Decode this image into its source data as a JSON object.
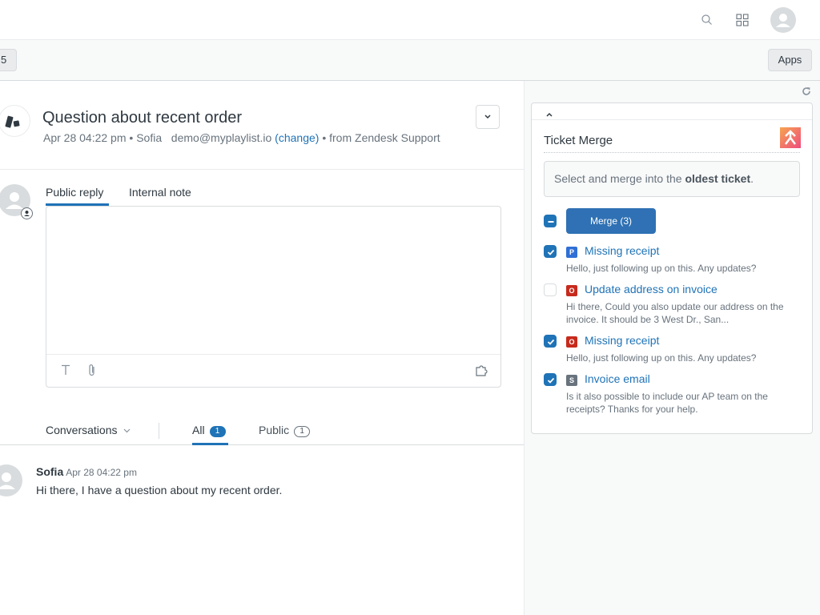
{
  "topbar": {
    "search_icon": "search-icon",
    "apps_grid_icon": "grid-icon",
    "avatar_icon": "user-avatar"
  },
  "subbar": {
    "tab_count": "5",
    "apps_button": "Apps"
  },
  "ticket": {
    "title": "Question about recent order",
    "date": "Apr 28 04:22 pm",
    "requester": "Sofia",
    "email": "demo@myplaylist.io",
    "change_link": "(change)",
    "source": "from Zendesk Support",
    "separator": "•"
  },
  "reply": {
    "tabs": [
      {
        "label": "Public reply",
        "active": true
      },
      {
        "label": "Internal note",
        "active": false
      }
    ],
    "text": "",
    "toolbar": [
      "text-format-icon",
      "attachment-icon",
      "apps-puzzle-icon"
    ]
  },
  "conversations": {
    "select_label": "Conversations",
    "filters": [
      {
        "label": "All",
        "count": "1",
        "active": true
      },
      {
        "label": "Public",
        "count": "1",
        "active": false
      }
    ]
  },
  "comments": [
    {
      "author": "Sofia",
      "time": "Apr 28 04:22 pm",
      "body": "Hi there, I have a question about my recent order."
    }
  ],
  "app": {
    "name": "Ticket Merge",
    "info_prefix": "Select and merge into the ",
    "info_bold": "oldest ticket",
    "info_suffix": ".",
    "merge_button": "Merge (3)",
    "select_all_state": "indeterminate",
    "brand_color": "#1f73b7",
    "tickets": [
      {
        "checked": true,
        "status": "P",
        "status_color": "#2f6fd6",
        "title": "Missing receipt",
        "desc": "Hello, just following up on this. Any updates?"
      },
      {
        "checked": false,
        "status": "O",
        "status_color": "#c72a1c",
        "title": "Update address on invoice",
        "desc": "Hi there, Could you also update our address on the invoice. It should be 3 West Dr., San..."
      },
      {
        "checked": true,
        "status": "O",
        "status_color": "#c72a1c",
        "title": "Missing receipt",
        "desc": "Hello, just following up on this. Any updates?"
      },
      {
        "checked": true,
        "status": "S",
        "status_color": "#68737d",
        "title": "Invoice email",
        "desc": "Is it also possible to include our AP team on the receipts? Thanks for your help."
      }
    ]
  }
}
